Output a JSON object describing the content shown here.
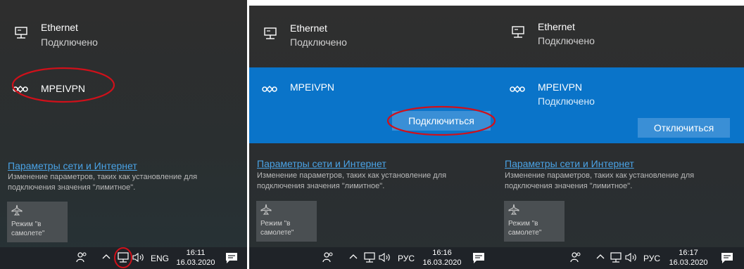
{
  "panels": [
    {
      "ethernet": {
        "name": "Ethernet",
        "status": "Подключено"
      },
      "vpn": {
        "name": "MPEIVPN"
      },
      "settings": {
        "link": "Параметры сети и Интернет",
        "description": "Изменение параметров, таких как установление для подключения значения \"лимитное\"."
      },
      "airplane": {
        "label": "Режим \"в самолете\""
      },
      "taskbar": {
        "lang": "ENG",
        "time": "16:11",
        "date": "16.03.2020"
      }
    },
    {
      "ethernet": {
        "name": "Ethernet",
        "status": "Подключено"
      },
      "vpn": {
        "name": "MPEIVPN",
        "button": "Подключиться"
      },
      "settings": {
        "link": "Параметры сети и Интернет",
        "description": "Изменение параметров, таких как установление для подключения значения \"лимитное\"."
      },
      "airplane": {
        "label": "Режим \"в самолете\""
      },
      "taskbar": {
        "lang": "РУС",
        "time": "16:16",
        "date": "16.03.2020"
      }
    },
    {
      "ethernet": {
        "name": "Ethernet",
        "status": "Подключено"
      },
      "vpn": {
        "name": "MPEIVPN",
        "status": "Подключено",
        "button": "Отключиться"
      },
      "settings": {
        "link": "Параметры сети и Интернет",
        "description": "Изменение параметров, таких как установление для подключения значения \"лимитное\"."
      },
      "airplane": {
        "label": "Режим \"в самолете\""
      },
      "taskbar": {
        "lang": "РУС",
        "time": "16:17",
        "date": "16.03.2020"
      }
    }
  ],
  "colors": {
    "accent": "#0a74c9",
    "button": "#3a8fd6",
    "link": "#4aa3e6",
    "annotation": "#d0101a"
  },
  "icons": [
    "ethernet-icon",
    "vpn-icon",
    "airplane-icon",
    "people-icon",
    "chevron-up-icon",
    "network-icon",
    "volume-icon",
    "notification-icon"
  ]
}
